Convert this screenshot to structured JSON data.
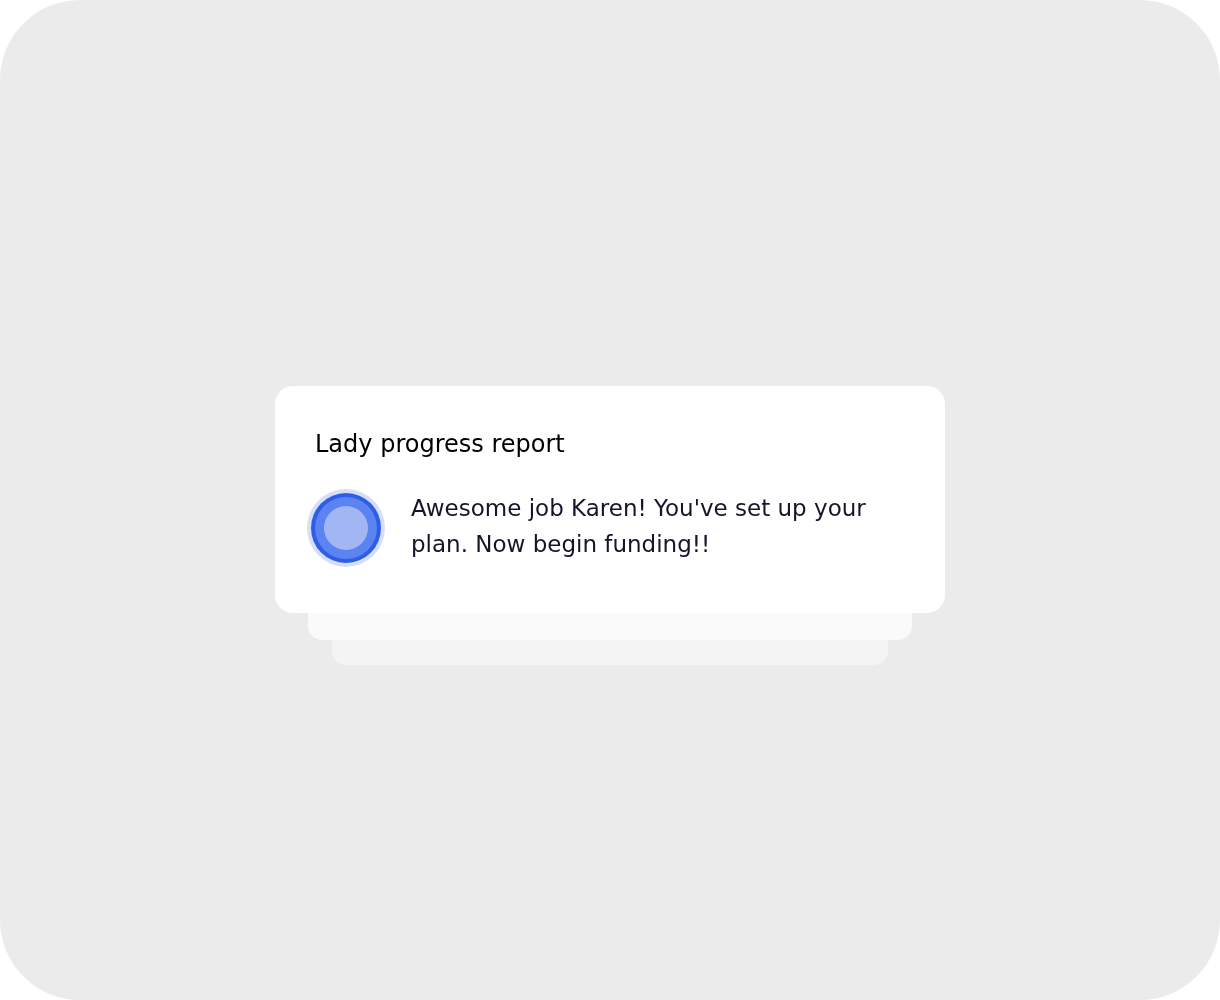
{
  "notification": {
    "title": "Lady progress report",
    "message": "Awesome job Karen! You've set up your plan. Now begin funding!!"
  }
}
